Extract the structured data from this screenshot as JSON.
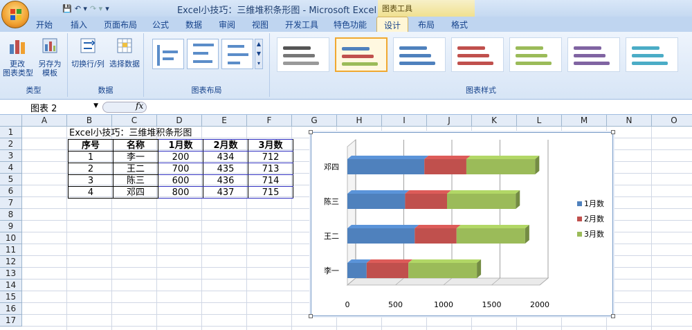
{
  "app": {
    "title": "Excel小技巧：三维堆积条形图 - Microsoft Excel",
    "context_tab_group": "图表工具"
  },
  "ribbon_tabs": [
    "开始",
    "插入",
    "页面布局",
    "公式",
    "数据",
    "审阅",
    "视图",
    "开发工具",
    "特色功能",
    "设计",
    "布局",
    "格式"
  ],
  "active_tab": "设计",
  "ribbon": {
    "type_group": {
      "label": "类型",
      "change_type": "更改\n图表类型",
      "save_template": "另存为\n模板"
    },
    "data_group": {
      "label": "数据",
      "switch_row_col": "切换行/列",
      "select_data": "选择数据"
    },
    "layout_group": {
      "label": "图表布局"
    },
    "style_group": {
      "label": "图表样式"
    }
  },
  "formula_bar": {
    "name_box": "图表 2",
    "fx": "fx"
  },
  "columns": [
    "A",
    "B",
    "C",
    "D",
    "E",
    "F",
    "G",
    "H",
    "I",
    "J",
    "K",
    "L",
    "M",
    "N",
    "O"
  ],
  "rows": [
    "1",
    "2",
    "3",
    "4",
    "5",
    "6",
    "7",
    "8",
    "9",
    "10",
    "11",
    "12",
    "13",
    "14",
    "15",
    "16",
    "17"
  ],
  "sheet": {
    "title": "Excel小技巧：三维堆积条形图",
    "headers": [
      "序号",
      "名称",
      "1月数",
      "2月数",
      "3月数"
    ],
    "rows": [
      [
        "1",
        "李一",
        "200",
        "434",
        "712"
      ],
      [
        "2",
        "王二",
        "700",
        "435",
        "713"
      ],
      [
        "3",
        "陈三",
        "600",
        "436",
        "714"
      ],
      [
        "4",
        "邓四",
        "800",
        "437",
        "715"
      ]
    ]
  },
  "chart_data": {
    "type": "bar",
    "orientation": "horizontal",
    "stacked": true,
    "three_d": true,
    "categories": [
      "李一",
      "王二",
      "陈三",
      "邓四"
    ],
    "series": [
      {
        "name": "1月数",
        "values": [
          200,
          700,
          600,
          800
        ],
        "color": "#4f81bd"
      },
      {
        "name": "2月数",
        "values": [
          434,
          435,
          436,
          437
        ],
        "color": "#c0504d"
      },
      {
        "name": "3月数",
        "values": [
          712,
          713,
          714,
          715
        ],
        "color": "#9bbb59"
      }
    ],
    "x_ticks": [
      "0",
      "500",
      "1000",
      "1500",
      "2000"
    ],
    "xlim": [
      0,
      2000
    ],
    "grid": true,
    "legend_position": "right"
  },
  "colors": {
    "ribbon": "#d7e5f6",
    "accent": "#f0a830",
    "grid": "#d0d7e5"
  }
}
